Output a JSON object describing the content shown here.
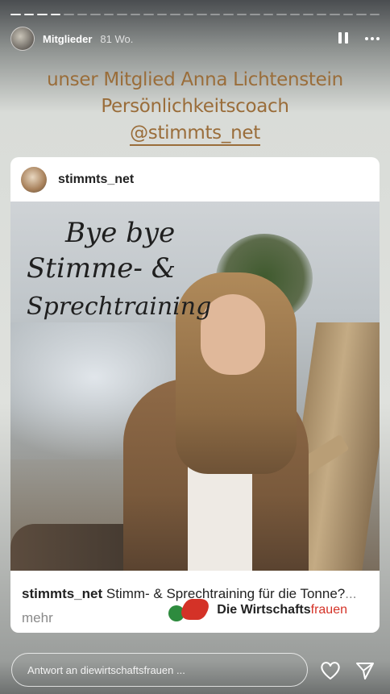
{
  "progress": {
    "total": 28,
    "current": 4
  },
  "header": {
    "username": "Mitglieder",
    "time": "81 Wo."
  },
  "headline": {
    "line1": "unser Mitglied Anna Lichtenstein",
    "line2": "Persönlichkeitscoach",
    "line3": "@stimmts_net"
  },
  "post": {
    "username": "stimmts_net",
    "image_script": {
      "line1": "Bye bye",
      "line2": "Stimme- &",
      "line3": "Sprechtraining"
    },
    "caption_user": "stimmts_net",
    "caption_text": " Stimm- & Sprechtraining für die Tonne?",
    "caption_more": "... mehr"
  },
  "brand": {
    "name_main": "Die Wirtschafts",
    "name_accent": "frauen"
  },
  "reply": {
    "placeholder": "Antwort an diewirtschaftsfrauen ..."
  }
}
